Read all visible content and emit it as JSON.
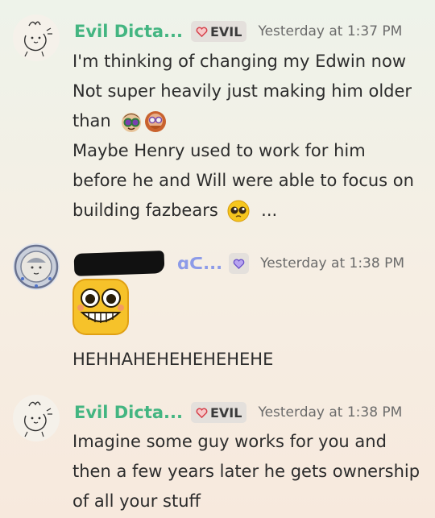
{
  "messages": [
    {
      "username": "Evil Dicta...",
      "tag": "EVIL",
      "timestamp": "Yesterday at 1:37 PM",
      "lines": [
        "I'm thinking of changing my Edwin now",
        "Not super heavily just making him older",
        "than",
        "Maybe Henry used to work for him",
        "before he and Will were able to focus on",
        "building fazbears",
        "..."
      ]
    },
    {
      "username_handle": "ɑᑕ...",
      "timestamp": "Yesterday at 1:38 PM",
      "text": "HEHHAHEHEHEHEHEHE"
    },
    {
      "username": "Evil Dicta...",
      "tag": "EVIL",
      "timestamp": "Yesterday at 1:38 PM",
      "lines": [
        "Imagine some guy works for you and",
        "then a few years later he gets ownership",
        "of all your stuff"
      ]
    }
  ],
  "colors": {
    "username": "#43b581",
    "handle": "#8d9be8",
    "timestamp": "#6b6b6b",
    "text": "#2c2c2c",
    "tag_bg": "#e4e0dc"
  }
}
